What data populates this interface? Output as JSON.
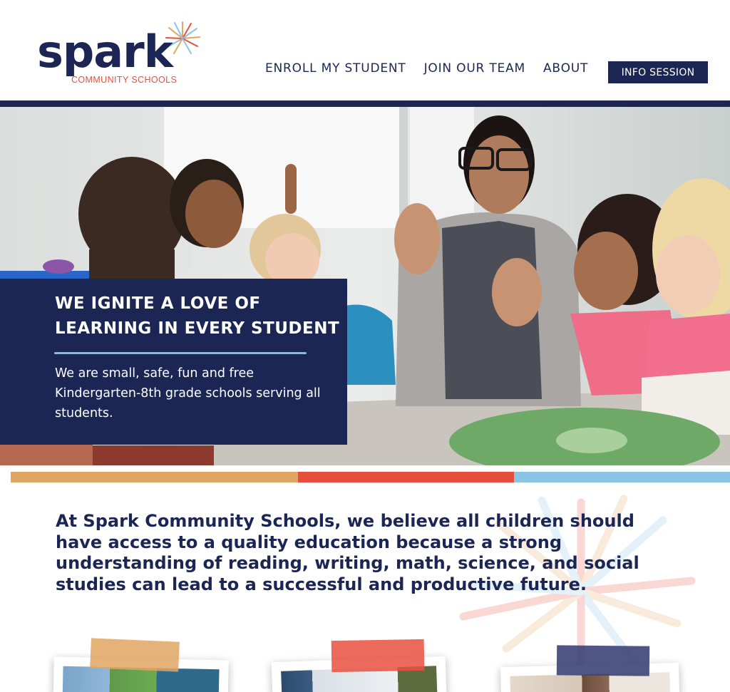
{
  "brand": {
    "name": "spark",
    "subtitle": "COMMUNITY SCHOOLS",
    "colors": {
      "navy": "#1c2654",
      "coral": "#e8503f",
      "gold": "#e0a663",
      "sky": "#8cc4e6"
    }
  },
  "nav": {
    "items": [
      {
        "label": "ENROLL MY STUDENT"
      },
      {
        "label": "JOIN OUR TEAM"
      },
      {
        "label": "ABOUT"
      }
    ],
    "cta_label": "INFO SESSION"
  },
  "hero": {
    "title": "WE IGNITE A LOVE OF LEARNING IN EVERY STUDENT",
    "text": "We are small, safe, fun and free Kindergarten-8th grade schools serving all students."
  },
  "mission": {
    "text": "At Spark Community Schools, we believe all children should have access to a quality education because a strong understanding of reading, writing, math, science, and social studies can lead to a successful and productive future."
  },
  "cards": [
    {
      "tape_color": "#e0a663"
    },
    {
      "tape_color": "#e8503f"
    },
    {
      "tape_color": "#3c4478"
    }
  ]
}
